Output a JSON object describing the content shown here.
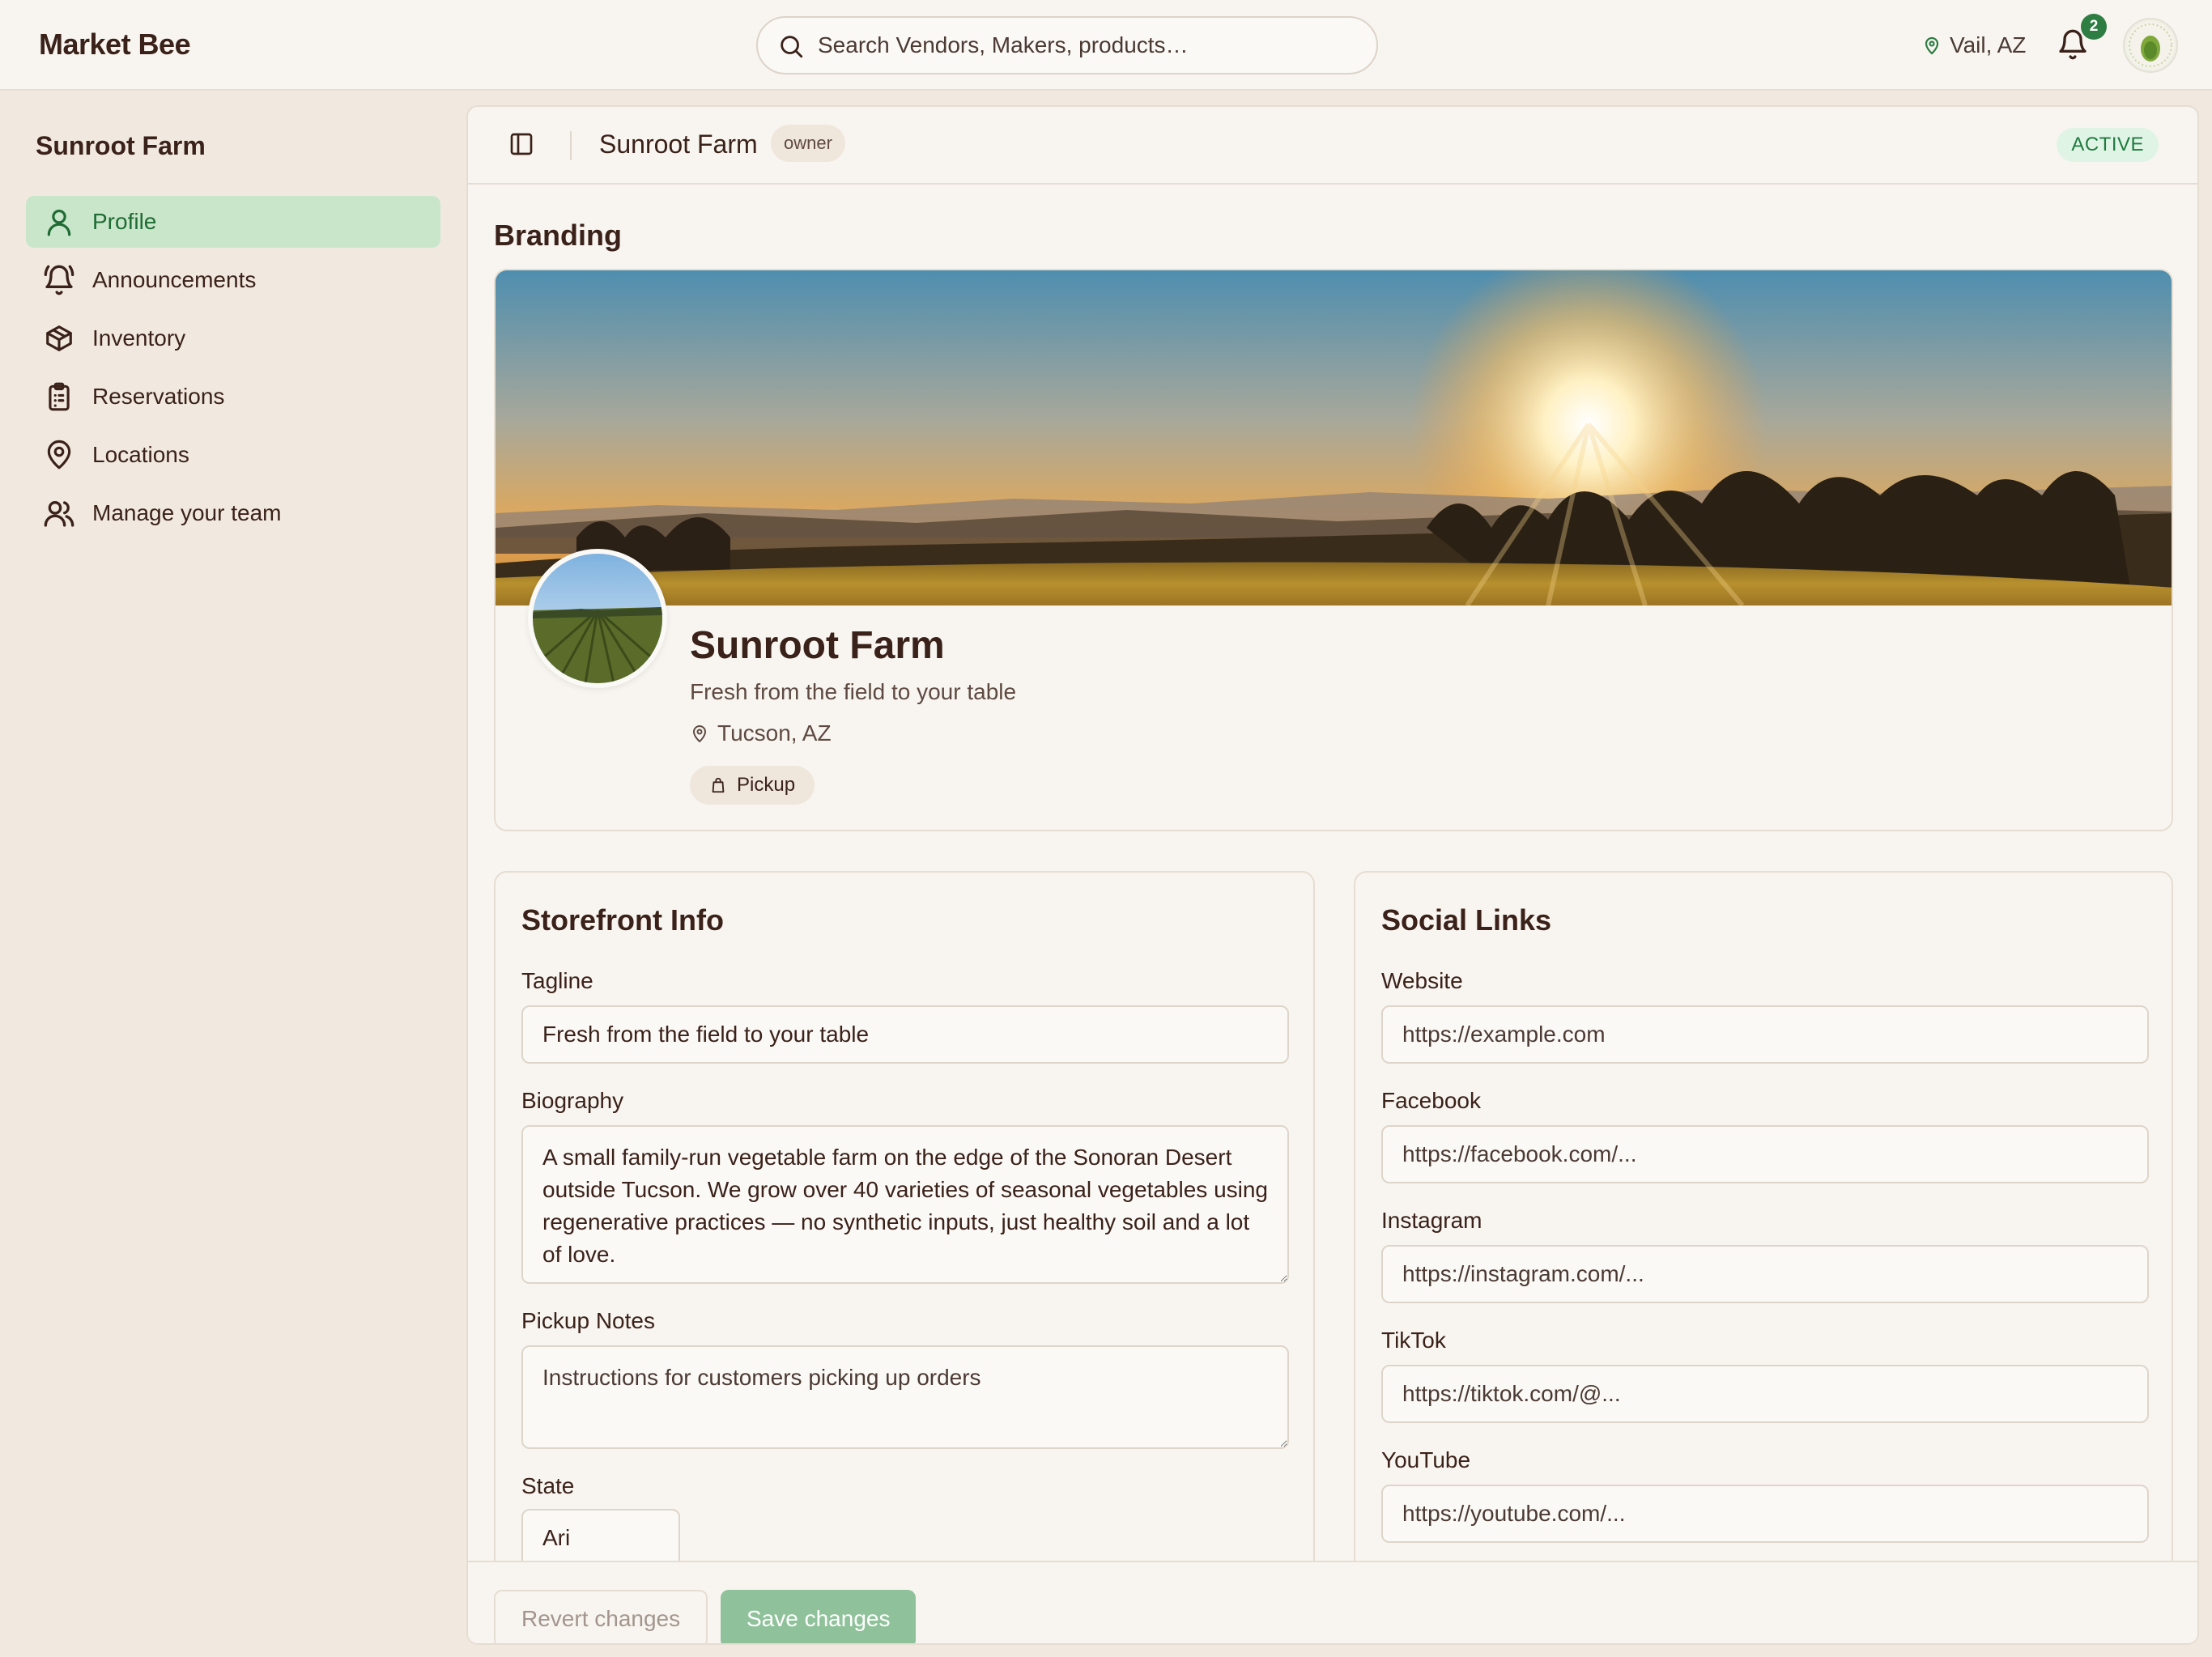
{
  "header": {
    "brand": "Market Bee",
    "search_placeholder": "Search Vendors, Makers, products…",
    "location": "Vail, AZ",
    "notification_count": "2",
    "icons": {
      "search": "search-icon",
      "location": "map-pin-icon",
      "bell": "bell-icon",
      "avatar": "user-avatar"
    }
  },
  "sidebar": {
    "title": "Sunroot Farm",
    "items": [
      {
        "label": "Profile",
        "icon": "user-icon",
        "active": true
      },
      {
        "label": "Announcements",
        "icon": "bell-ring-icon",
        "active": false
      },
      {
        "label": "Inventory",
        "icon": "package-icon",
        "active": false
      },
      {
        "label": "Reservations",
        "icon": "clipboard-list-icon",
        "active": false
      },
      {
        "label": "Locations",
        "icon": "map-pin-icon",
        "active": false
      },
      {
        "label": "Manage your team",
        "icon": "users-icon",
        "active": false
      }
    ]
  },
  "main_header": {
    "title": "Sunroot Farm",
    "role": "owner",
    "status": "ACTIVE",
    "toggle_icon": "sidebar-panel-icon"
  },
  "branding": {
    "section_title": "Branding",
    "name": "Sunroot Farm",
    "tagline": "Fresh from the field to your table",
    "location": "Tucson, AZ",
    "chip": "Pickup",
    "chip_icon": "shopping-bag-icon"
  },
  "storefront": {
    "title": "Storefront Info",
    "tagline_label": "Tagline",
    "tagline_value": "Fresh from the field to your table",
    "biography_label": "Biography",
    "biography_value": "A small family-run vegetable farm on the edge of the Sonoran Desert outside Tucson. We grow over 40 varieties of seasonal vegetables using regenerative practices — no synthetic inputs, just healthy soil and a lot of love.",
    "pickup_label": "Pickup Notes",
    "pickup_placeholder": "Instructions for customers picking up orders",
    "state_label": "State",
    "state_value": "Ari"
  },
  "social": {
    "title": "Social Links",
    "fields": [
      {
        "label": "Website",
        "placeholder": "https://example.com"
      },
      {
        "label": "Facebook",
        "placeholder": "https://facebook.com/..."
      },
      {
        "label": "Instagram",
        "placeholder": "https://instagram.com/..."
      },
      {
        "label": "TikTok",
        "placeholder": "https://tiktok.com/@..."
      },
      {
        "label": "YouTube",
        "placeholder": "https://youtube.com/..."
      }
    ]
  },
  "footer": {
    "revert": "Revert changes",
    "save": "Save changes"
  },
  "colors": {
    "accent_green": "#2e7d43",
    "active_nav_bg": "#c9e6cb",
    "save_button": "#8fc29a",
    "text_brown": "#3a2119",
    "background": "#f1e9e0"
  }
}
